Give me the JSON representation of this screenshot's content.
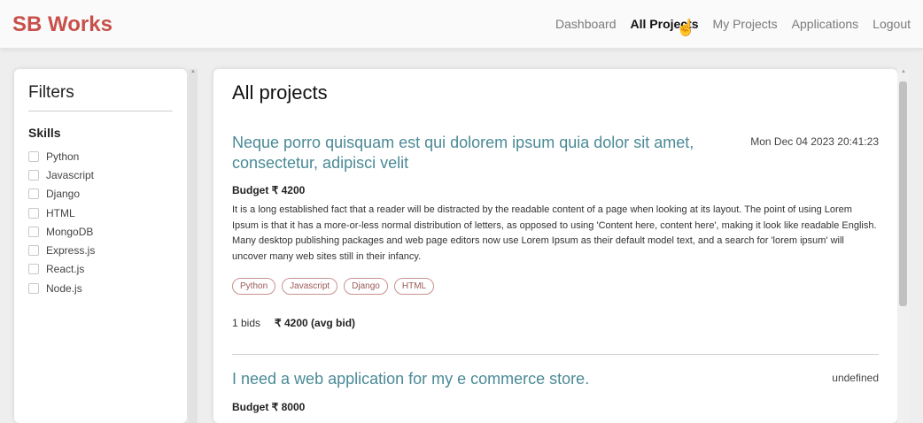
{
  "navbar": {
    "brand": "SB Works",
    "links": [
      "Dashboard",
      "All Projects",
      "My Projects",
      "Applications",
      "Logout"
    ],
    "active": "All Projects"
  },
  "filters": {
    "title": "Filters",
    "skills_heading": "Skills",
    "skills": [
      "Python",
      "Javascript",
      "Django",
      "HTML",
      "MongoDB",
      "Express.js",
      "React.js",
      "Node.js"
    ]
  },
  "main": {
    "title": "All projects",
    "projects": [
      {
        "title": "Neque porro quisquam est qui dolorem ipsum quia dolor sit amet, consectetur, adipisci velit",
        "date": "Mon Dec 04 2023 20:41:23",
        "budget": "Budget ₹ 4200",
        "description": "It is a long established fact that a reader will be distracted by the readable content of a page when looking at its layout. The point of using Lorem Ipsum is that it has a more-or-less normal distribution of letters, as opposed to using 'Content here, content here', making it look like readable English. Many desktop publishing packages and web page editors now use Lorem Ipsum as their default model text, and a search for 'lorem ipsum' will uncover many web sites still in their infancy.",
        "tags": [
          "Python",
          "Javascript",
          "Django",
          "HTML"
        ],
        "bids": "1 bids",
        "avg_bid": "₹ 4200 (avg bid)"
      },
      {
        "title": "I need a web application for my e commerce store.",
        "date": "undefined",
        "budget": "Budget ₹ 8000"
      }
    ]
  },
  "colors": {
    "brand": "#c8504a",
    "project_title": "#4a8a96",
    "tag_border": "#c9918f"
  },
  "icons": {
    "cursor": "hand-pointer-icon"
  }
}
